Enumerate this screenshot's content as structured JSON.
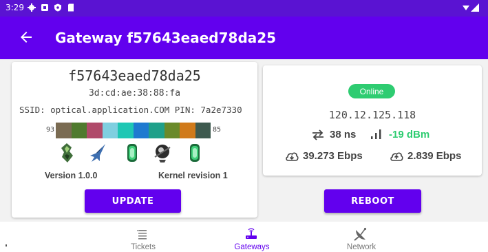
{
  "status_bar": {
    "time": "3:29"
  },
  "app_bar": {
    "title": "Gateway f57643eaed78da25"
  },
  "gateway": {
    "name": "f57643eaed78da25",
    "mac": "3d:cd:ae:38:88:fa",
    "ssid_line": "SSID: optical.application.COM  PIN: 7a2e7330",
    "colorbar_left": "93",
    "colorbar_right": "85",
    "colorbar_colors": [
      "#7a6b52",
      "#4f7a2e",
      "#b04a6a",
      "#7fcfe0",
      "#1fc7b4",
      "#1f7ad0",
      "#1fa08a",
      "#6a8a2a",
      "#d07a1a",
      "#3e5a4f"
    ],
    "version": "Version 1.0.0",
    "kernel": "Kernel revision 1",
    "update_label": "UPDATE"
  },
  "status": {
    "online_label": "Online",
    "ip": "120.12.125.118",
    "latency": "38 ns",
    "signal": "-19 dBm",
    "download": "39.273 Ebps",
    "upload": "2.839 Ebps",
    "reboot_label": "REBOOT"
  },
  "nav": {
    "tickets": "Tickets",
    "gateways": "Gateways",
    "network": "Network"
  },
  "colors": {
    "primary": "#6200ee",
    "status_bar": "#5a13d2",
    "online": "#2ecc71"
  }
}
